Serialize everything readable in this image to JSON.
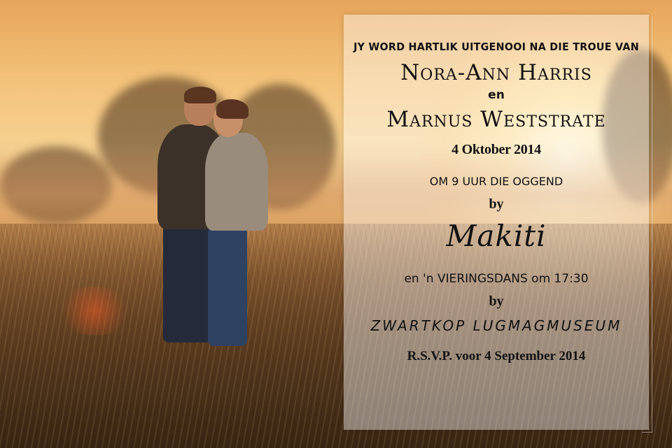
{
  "invitation": {
    "intro": "JY WORD HARTLIK UITGENOOI NA DIE TROUE VAN",
    "bride": "Nora-Ann Harris",
    "conjunction": "en",
    "groom": "Marnus Weststrate",
    "date": "4 Oktober 2014",
    "ceremony_time": "OM 9 UUR DIE OGGEND",
    "by_1": "by",
    "ceremony_venue": "Makiti",
    "celebration": "en 'n VIERINGSDANS om 17:30",
    "by_2": "by",
    "reception_venue": "ZWARTKOP LUGMAGMUSEUM",
    "rsvp": "R.S.V.P. voor 4 September 2014"
  },
  "colors": {
    "text": "#111111",
    "overlay": "rgba(255,255,255,0.42)",
    "sunset": "#f3c27a"
  }
}
